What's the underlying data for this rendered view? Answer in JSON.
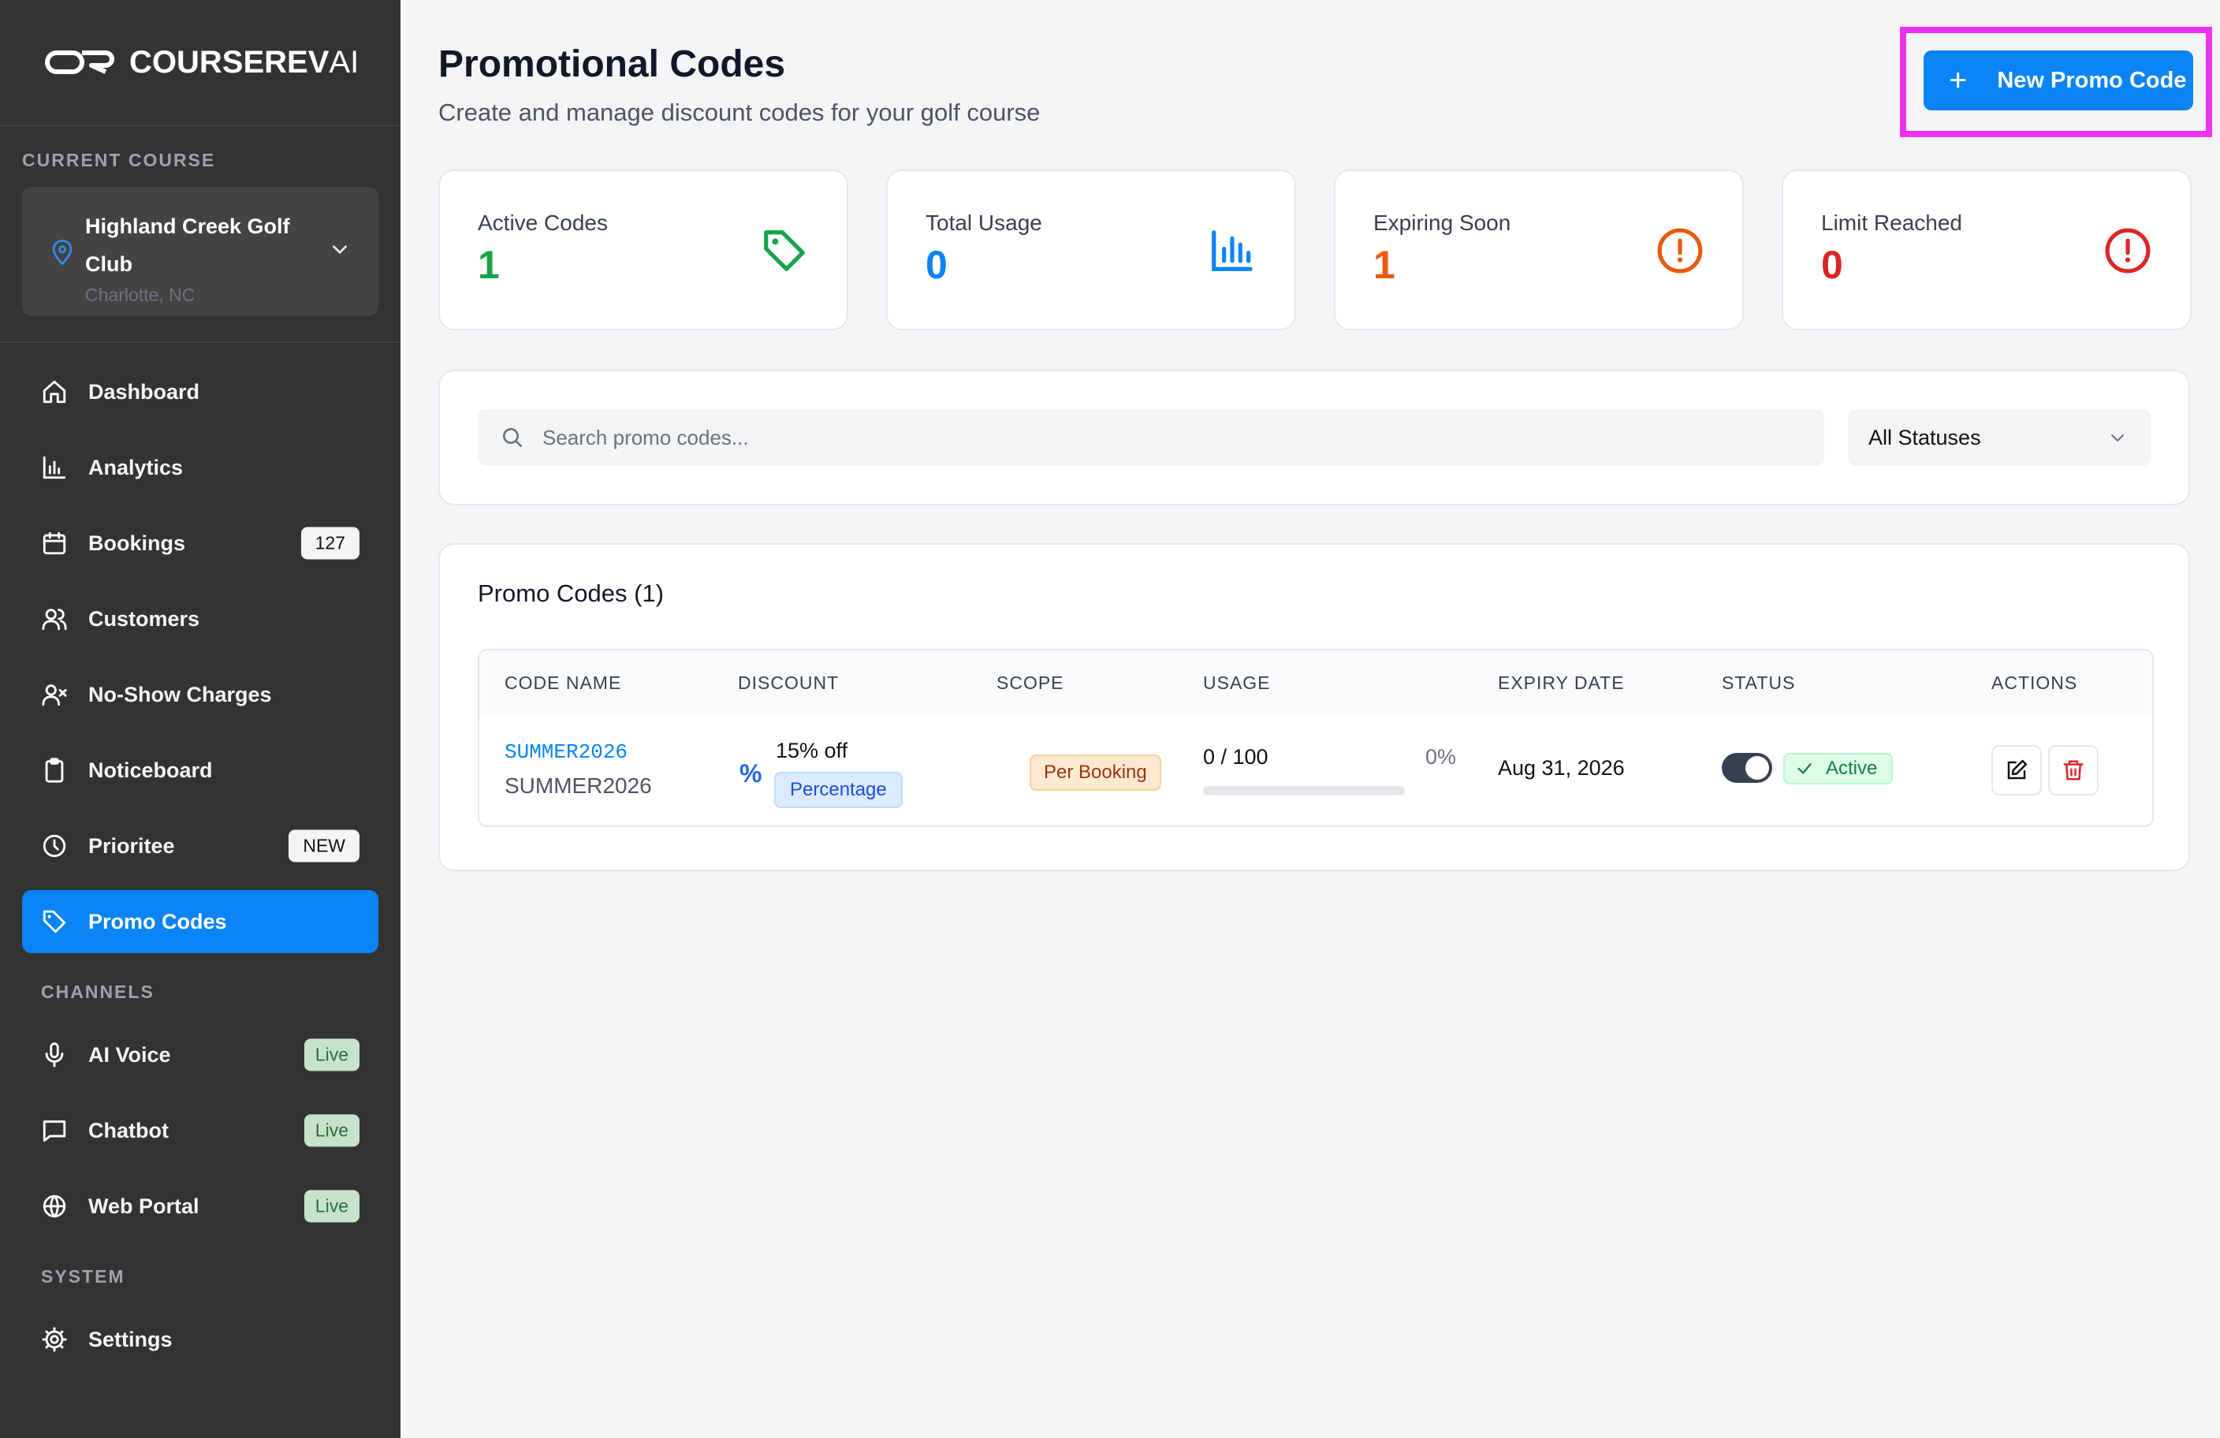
{
  "brand": {
    "name_main": "COURSEREV",
    "name_ai": "AI"
  },
  "sidebar": {
    "current_course_label": "CURRENT COURSE",
    "course": {
      "name": "Highland Creek Golf Club",
      "location": "Charlotte, NC"
    },
    "items": [
      {
        "label": "Dashboard",
        "icon": "home-icon"
      },
      {
        "label": "Analytics",
        "icon": "bar-chart-icon"
      },
      {
        "label": "Bookings",
        "icon": "calendar-icon",
        "badge": "127"
      },
      {
        "label": "Customers",
        "icon": "users-icon"
      },
      {
        "label": "No-Show Charges",
        "icon": "user-x-icon"
      },
      {
        "label": "Noticeboard",
        "icon": "clipboard-icon"
      },
      {
        "label": "Prioritee",
        "icon": "clock-icon",
        "badge": "NEW"
      },
      {
        "label": "Promo Codes",
        "icon": "tag-icon",
        "active": true
      }
    ],
    "channels_label": "CHANNELS",
    "channels": [
      {
        "label": "AI Voice",
        "icon": "mic-icon",
        "badge": "Live"
      },
      {
        "label": "Chatbot",
        "icon": "message-icon",
        "badge": "Live"
      },
      {
        "label": "Web Portal",
        "icon": "globe-icon",
        "badge": "Live"
      }
    ],
    "system_label": "SYSTEM",
    "system": [
      {
        "label": "Settings",
        "icon": "gear-icon"
      }
    ]
  },
  "header": {
    "title": "Promotional Codes",
    "subtitle": "Create and manage discount codes for your golf course",
    "new_button_label": "New Promo Code"
  },
  "stats": [
    {
      "label": "Active Codes",
      "value": "1",
      "color": "#16a34a",
      "icon": "tag-icon"
    },
    {
      "label": "Total Usage",
      "value": "0",
      "color": "#0a84f5",
      "icon": "bar-chart-icon"
    },
    {
      "label": "Expiring Soon",
      "value": "1",
      "color": "#ea580c",
      "icon": "alert-circle-icon"
    },
    {
      "label": "Limit Reached",
      "value": "0",
      "color": "#dc2626",
      "icon": "alert-circle-icon"
    }
  ],
  "filters": {
    "search_placeholder": "Search promo codes...",
    "status_value": "All Statuses"
  },
  "codes": {
    "title": "Promo Codes (1)",
    "columns": [
      "CODE NAME",
      "DISCOUNT",
      "SCOPE",
      "USAGE",
      "EXPIRY DATE",
      "STATUS",
      "ACTIONS"
    ],
    "rows": [
      {
        "code": "SUMMER2026",
        "name": "SUMMER2026",
        "discount": "15% off",
        "discount_type": "Percentage",
        "scope": "Per Booking",
        "usage": "0 / 100",
        "usage_pct": "0%",
        "usage_fraction": 0,
        "expiry": "Aug 31, 2026",
        "status": "Active",
        "enabled": true
      }
    ]
  }
}
